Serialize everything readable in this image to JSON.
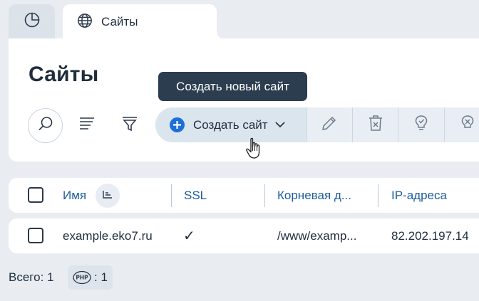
{
  "tabs": [
    {
      "icon": "dashboard-pie-icon",
      "label": ""
    },
    {
      "icon": "globe-icon",
      "label": "Сайты"
    }
  ],
  "page": {
    "title": "Сайты"
  },
  "tooltip": {
    "text": "Создать новый сайт"
  },
  "toolbar": {
    "create_label": "Создать сайт",
    "icons": [
      "search-icon",
      "list-lines-icon",
      "filter-icon",
      "plus-circle-icon",
      "chevron-down-icon",
      "pencil-icon",
      "trash-icon",
      "lightbulb-icon"
    ]
  },
  "table": {
    "columns": [
      "Имя",
      "SSL",
      "Корневая д...",
      "IP-адреса"
    ],
    "rows": [
      {
        "name": "example.eko7.ru",
        "ssl": "✓",
        "root": "/www/examp...",
        "ip": "82.202.197.14"
      }
    ]
  },
  "footer": {
    "total_label": "Всего: 1",
    "php_label": "PHP",
    "php_count": ": 1"
  },
  "colors": {
    "accent": "#1e6fd9",
    "header_text": "#1d5c9e",
    "tooltip_bg": "#2c3d4f",
    "page_bg": "#e9edf2"
  }
}
